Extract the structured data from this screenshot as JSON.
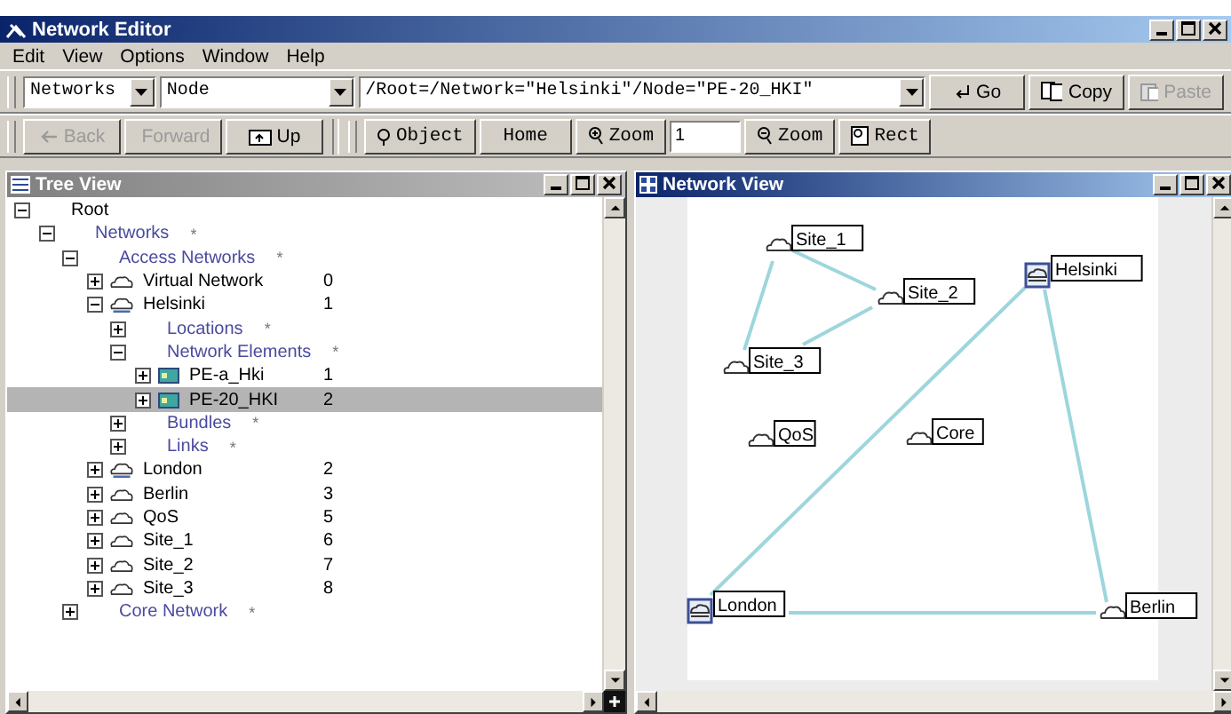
{
  "window": {
    "title": "Network Editor"
  },
  "menu": [
    "Edit",
    "View",
    "Options",
    "Window",
    "Help"
  ],
  "toolbar": {
    "scope": "Networks",
    "type": "Node",
    "path": "/Root=/Network=\"Helsinki\"/Node=\"PE-20_HKI\"",
    "buttons": [
      {
        "label": "Go",
        "disabled": false
      },
      {
        "label": "Copy",
        "disabled": false
      },
      {
        "label": "Paste",
        "disabled": true
      }
    ]
  },
  "nav": [
    {
      "label": "Back",
      "disabled": true
    },
    {
      "label": "Forward",
      "disabled": true
    },
    {
      "label": "Up",
      "disabled": false
    }
  ],
  "view_tools": {
    "object": "Object",
    "home": "Home",
    "zoom_in": "Zoom",
    "zoom_value": "1",
    "zoom_out": "Zoom",
    "rect": "Rect"
  },
  "tree_view": {
    "title": "Tree View",
    "active": false,
    "items": [
      {
        "label": "Root",
        "kind": "root",
        "expanded": true,
        "selected": false,
        "children": [
          {
            "label": "Networks",
            "kind": "category",
            "count": "*",
            "expanded": true,
            "selected": false,
            "children": [
              {
                "label": "Access Networks",
                "kind": "category",
                "count": "*",
                "expanded": true,
                "selected": false,
                "children": [
                  {
                    "label": "Virtual Network",
                    "kind": "network",
                    "count": "0",
                    "expanded": false,
                    "selected": false
                  },
                  {
                    "label": "Helsinki",
                    "kind": "site",
                    "count": "1",
                    "expanded": true,
                    "selected": false,
                    "children": [
                      {
                        "label": "Locations",
                        "kind": "category",
                        "count": "*",
                        "expanded": false,
                        "selected": false
                      },
                      {
                        "label": "Network Elements",
                        "kind": "category",
                        "count": "*",
                        "expanded": true,
                        "selected": false,
                        "children": [
                          {
                            "label": "PE-a_Hki",
                            "kind": "element",
                            "count": "1",
                            "expanded": false,
                            "selected": false
                          },
                          {
                            "label": "PE-20_HKI",
                            "kind": "element",
                            "count": "2",
                            "expanded": false,
                            "selected": true
                          }
                        ]
                      },
                      {
                        "label": "Bundles",
                        "kind": "category",
                        "count": "*",
                        "expanded": false,
                        "selected": false
                      },
                      {
                        "label": "Links",
                        "kind": "category",
                        "count": "*",
                        "expanded": false,
                        "selected": false
                      }
                    ]
                  },
                  {
                    "label": "London",
                    "kind": "site",
                    "count": "2",
                    "expanded": false,
                    "selected": false
                  },
                  {
                    "label": "Berlin",
                    "kind": "network",
                    "count": "3",
                    "expanded": false,
                    "selected": false
                  },
                  {
                    "label": "QoS",
                    "kind": "network",
                    "count": "5",
                    "expanded": false,
                    "selected": false
                  },
                  {
                    "label": "Site_1",
                    "kind": "network",
                    "count": "6",
                    "expanded": false,
                    "selected": false
                  },
                  {
                    "label": "Site_2",
                    "kind": "network",
                    "count": "7",
                    "expanded": false,
                    "selected": false
                  },
                  {
                    "label": "Site_3",
                    "kind": "network",
                    "count": "8",
                    "expanded": false,
                    "selected": false
                  }
                ]
              },
              {
                "label": "Core Network",
                "kind": "category",
                "count": "*",
                "expanded": false,
                "selected": false
              }
            ]
          }
        ]
      }
    ]
  },
  "network_view": {
    "title": "Network View",
    "active": true,
    "nodes": [
      {
        "name": "Site_1",
        "kind": "network"
      },
      {
        "name": "Helsinki",
        "kind": "site"
      },
      {
        "name": "Site_2",
        "kind": "network"
      },
      {
        "name": "Site_3",
        "kind": "network"
      },
      {
        "name": "QoS",
        "kind": "network"
      },
      {
        "name": "Core",
        "kind": "network"
      },
      {
        "name": "London",
        "kind": "site"
      },
      {
        "name": "Berlin",
        "kind": "network"
      }
    ]
  }
}
